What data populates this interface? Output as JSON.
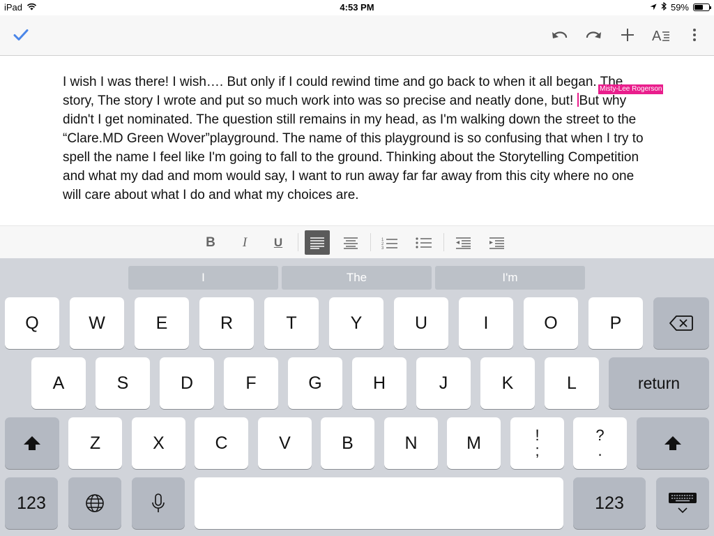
{
  "status": {
    "device": "iPad",
    "time": "4:53 PM",
    "battery": "59%",
    "battery_level": 0.59
  },
  "toolbar": {
    "done": "checkmark-icon",
    "undo": "undo-icon",
    "redo": "redo-icon",
    "insert": "plus-icon",
    "format": "text-format-icon",
    "more": "more-vertical-icon",
    "accent": "#4a86e8"
  },
  "document": {
    "text_before_cursor": "I wish I was there! I wish…. But only if I could rewind time and go back to when it all began. The story, The story I wrote and put so much work into was so precise and neatly done, but! ",
    "text_after_cursor": "But why didn't I get nominated. The question still remains in my head, as I'm walking down the street to the “Clare.MD Green Wover”playground. The name of this playground is so confusing that when I try to spell the name I feel like I'm going to fall to the ground. Thinking about the Storytelling Competition and what my dad and mom would say, I want to run away far far away from this city where no one will care about what I do and what my choices are.",
    "collaborator": "Misty-Lee Rogerson",
    "collaborator_color": "#e91e8c"
  },
  "format_bar": {
    "bold": "B",
    "italic": "I",
    "underline": "U",
    "align_left": "align-left-icon",
    "align_center": "align-center-icon",
    "numbered_list": "numbered-list-icon",
    "bulleted_list": "bulleted-list-icon",
    "decrease_indent": "outdent-icon",
    "increase_indent": "indent-icon"
  },
  "keyboard": {
    "suggestions": [
      "I",
      "The",
      "I'm"
    ],
    "row1": [
      "Q",
      "W",
      "E",
      "R",
      "T",
      "Y",
      "U",
      "I",
      "O",
      "P"
    ],
    "row2": [
      "A",
      "S",
      "D",
      "F",
      "G",
      "H",
      "J",
      "K",
      "L"
    ],
    "row3": [
      "Z",
      "X",
      "C",
      "V",
      "B",
      "N",
      "M"
    ],
    "punct1": [
      "!",
      ";"
    ],
    "punct2": [
      "?",
      "."
    ],
    "return": "return",
    "num_left": "123",
    "num_right": "123",
    "icons": {
      "backspace": "backspace-icon",
      "shift": "shift-icon",
      "globe": "globe-icon",
      "mic": "microphone-icon",
      "hide": "keyboard-dismiss-icon"
    }
  }
}
